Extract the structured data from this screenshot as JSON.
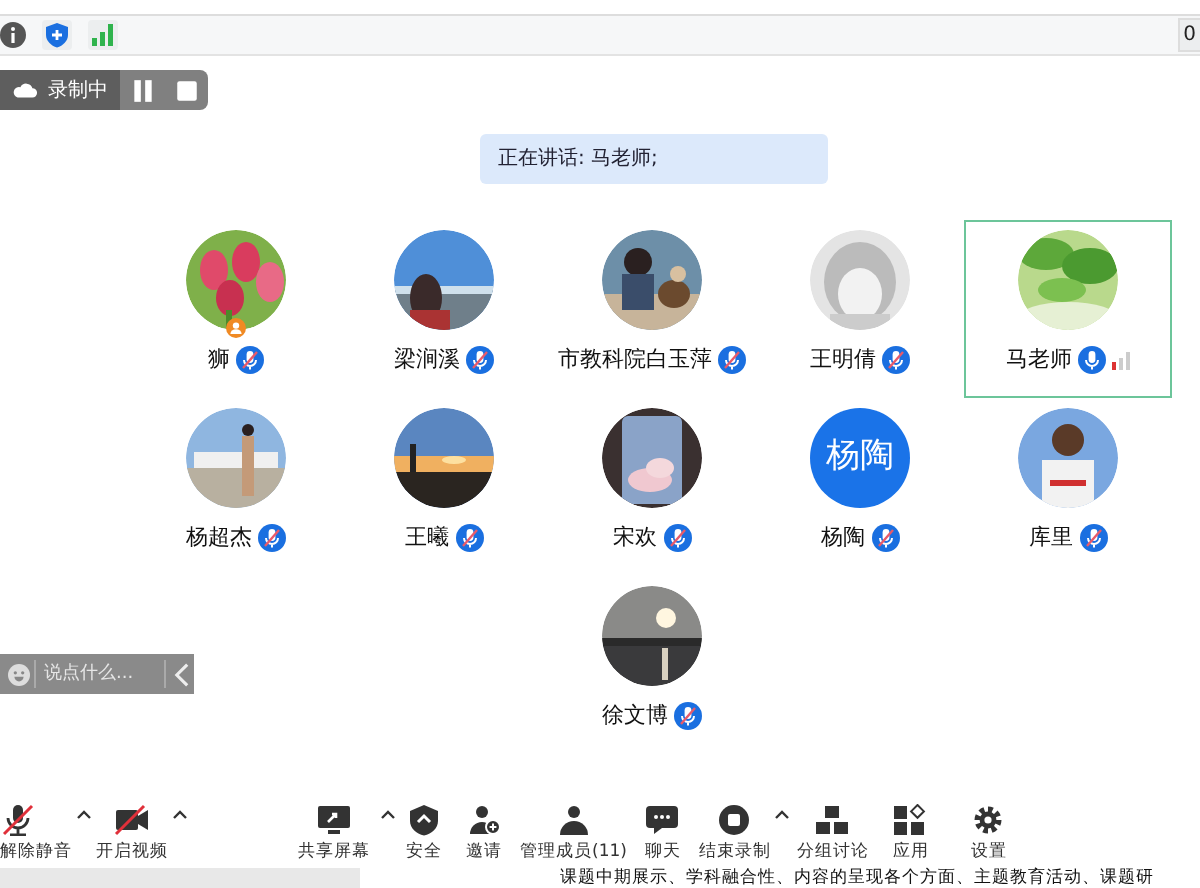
{
  "top_bar": {
    "counter": "0"
  },
  "recording": {
    "label": "录制中",
    "paused": false
  },
  "speaker_banner": "正在讲话: 马老师;",
  "participants": [
    {
      "name": "狮",
      "kind": "picture",
      "muted": true,
      "host": true,
      "speaking": false
    },
    {
      "name": "梁涧溪",
      "kind": "picture",
      "muted": true,
      "host": false,
      "speaking": false
    },
    {
      "name": "市教科院白玉萍",
      "kind": "picture",
      "muted": true,
      "host": false,
      "speaking": false
    },
    {
      "name": "王明倩",
      "kind": "picture",
      "muted": true,
      "host": false,
      "speaking": false
    },
    {
      "name": "马老师",
      "kind": "picture",
      "muted": false,
      "host": false,
      "speaking": true
    },
    {
      "name": "杨超杰",
      "kind": "picture",
      "muted": true,
      "host": false,
      "speaking": false
    },
    {
      "name": "王曦",
      "kind": "picture",
      "muted": true,
      "host": false,
      "speaking": false
    },
    {
      "name": "宋欢",
      "kind": "picture",
      "muted": true,
      "host": false,
      "speaking": false
    },
    {
      "name": "杨陶",
      "kind": "text",
      "avatar_text": "杨陶",
      "muted": true,
      "host": false,
      "speaking": false
    },
    {
      "name": "库里",
      "kind": "picture",
      "muted": true,
      "host": false,
      "speaking": false
    },
    {
      "name": "徐文博",
      "kind": "picture",
      "muted": true,
      "host": false,
      "speaking": false
    }
  ],
  "chat": {
    "placeholder": "说点什么..."
  },
  "toolbar": [
    {
      "label": "解除静音",
      "caret": true
    },
    {
      "label": "开启视频",
      "caret": true
    },
    {
      "label": "共享屏幕",
      "caret": true
    },
    {
      "label": "安全"
    },
    {
      "label": "邀请"
    },
    {
      "label": "管理成员(11)"
    },
    {
      "label": "聊天"
    },
    {
      "label": "结束录制",
      "caret": true
    },
    {
      "label": "分组讨论"
    },
    {
      "label": "应用"
    },
    {
      "label": "设置"
    }
  ],
  "ticker": "课题中期展示、学科融合性、内容的呈现各个方面、主题教育活动、课题研"
}
